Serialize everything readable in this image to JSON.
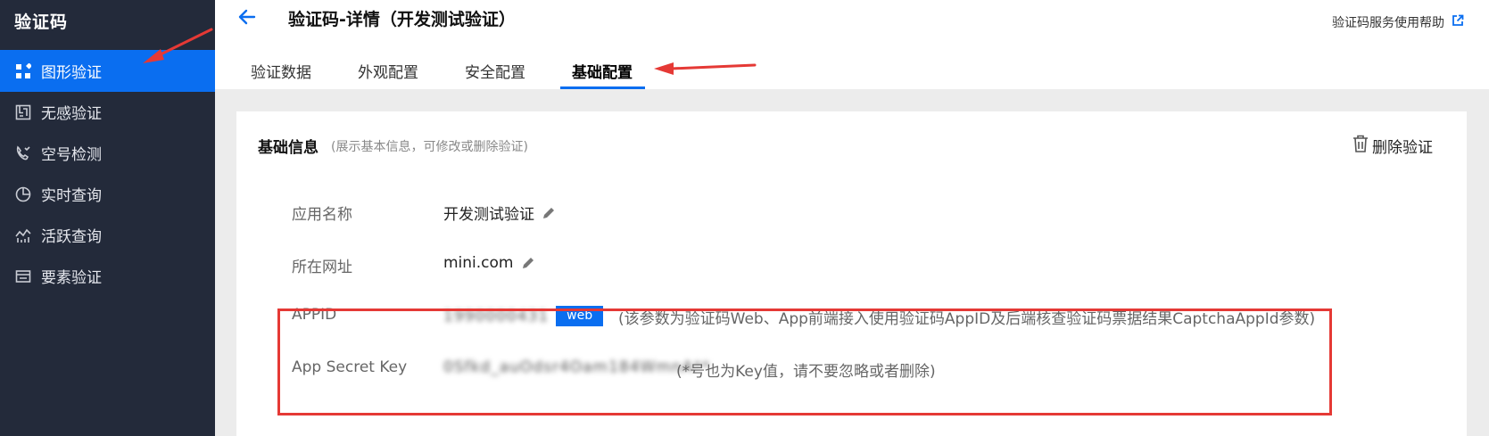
{
  "sidebar": {
    "brand": "验证码",
    "items": [
      {
        "label": "图形验证",
        "icon": "grid-apps-icon"
      },
      {
        "label": "无感验证",
        "icon": "maze-icon"
      },
      {
        "label": "空号检测",
        "icon": "phone-check-icon"
      },
      {
        "label": "实时查询",
        "icon": "pie-clock-icon"
      },
      {
        "label": "活跃查询",
        "icon": "activity-chart-icon"
      },
      {
        "label": "要素验证",
        "icon": "id-card-icon"
      }
    ]
  },
  "header": {
    "title": "验证码-详情（开发测试验证）",
    "help_link": "验证码服务使用帮助"
  },
  "tabs": [
    {
      "label": "验证数据"
    },
    {
      "label": "外观配置"
    },
    {
      "label": "安全配置"
    },
    {
      "label": "基础配置",
      "active": true
    }
  ],
  "section": {
    "title": "基础信息",
    "subtitle": "(展示基本信息，可修改或删除验证)",
    "delete_label": "删除验证"
  },
  "fields": {
    "app_name": {
      "label": "应用名称",
      "value": "开发测试验证"
    },
    "site_url": {
      "label": "所在网址",
      "value": "mini.com"
    },
    "appid": {
      "label": "APPID",
      "value": "1990000431",
      "tag": "web",
      "note": "(该参数为验证码Web、App前端接入使用验证码AppID及后端核查验证码票据结果CaptchaAppId参数)"
    },
    "secret": {
      "label": "App Secret Key",
      "value": "0Sfkd_auOdsr4Oam184WmnA**",
      "note": "(*号也为Key值，请不要忽略或者删除)"
    }
  },
  "colors": {
    "accent": "#0a6ef0",
    "sidebar_bg": "#232a3a",
    "highlight": "#e53935"
  }
}
